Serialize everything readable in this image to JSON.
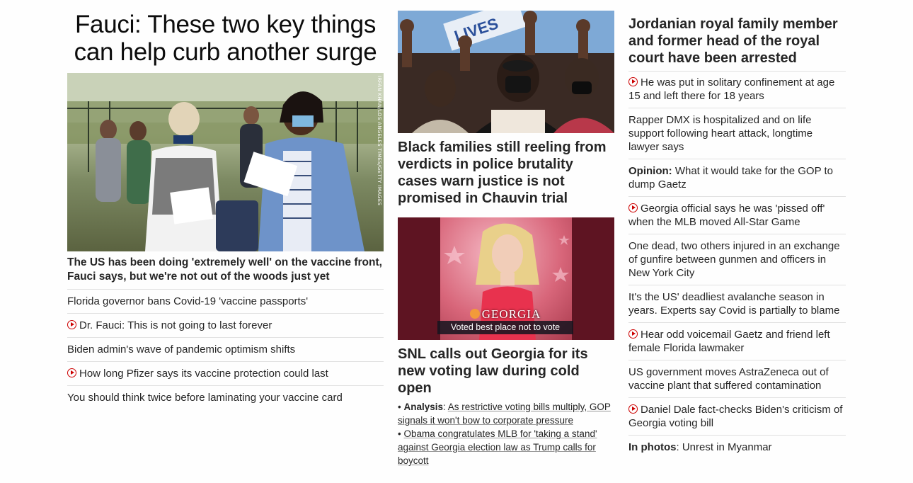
{
  "lead": {
    "headline": "Fauci: These two key things can help curb another surge",
    "photo_credit": "IRFAN KHAN/LOS ANGELES TIMES/GETTY IMAGES",
    "subhead": "The US has been doing 'extremely well' on the vaccine front, Fauci says, but we're not out of the woods just yet",
    "related": [
      {
        "text": "Florida governor bans Covid-19 'vaccine passports'",
        "video": false
      },
      {
        "text": "Dr. Fauci: This is not going to last forever",
        "video": true
      },
      {
        "text": "Biden admin's wave of pandemic optimism shifts",
        "video": false
      },
      {
        "text": "How long Pfizer says its vaccine protection could last",
        "video": true
      },
      {
        "text": "You should think twice before laminating your vaccine card",
        "video": false
      }
    ]
  },
  "middle": {
    "story1_headline": "Black families still reeling from verdicts in police brutality cases warn justice is not promised in Chauvin trial",
    "story1_sign": "LIVES",
    "story2_headline": "SNL calls out Georgia for its new voting law during cold open",
    "story2_lower_third_title": "GEORGIA",
    "story2_lower_third_caption": "Voted best place not to vote",
    "bullets": [
      {
        "prefix": "Analysis",
        "text": "As restrictive voting bills multiply, GOP signals it won't bow to corporate pressure"
      },
      {
        "prefix": "",
        "text": "Obama congratulates MLB for 'taking a stand' against Georgia election law as Trump calls for boycott"
      }
    ]
  },
  "right": {
    "headline": "Jordanian royal family member and former head of the royal court have been arrested",
    "items": [
      {
        "prefix": "",
        "text": "He was put in solitary confinement at age 15 and left there for 18 years",
        "video": true
      },
      {
        "prefix": "",
        "text": "Rapper DMX is hospitalized and on life support following heart attack, longtime lawyer says",
        "video": false
      },
      {
        "prefix": "Opinion:",
        "text": " What it would take for the GOP to dump Gaetz",
        "video": false
      },
      {
        "prefix": "",
        "text": "Georgia official says he was 'pissed off' when the MLB moved All-Star Game",
        "video": true
      },
      {
        "prefix": "",
        "text": "One dead, two others injured in an exchange of gunfire between gunmen and officers in New York City",
        "video": false
      },
      {
        "prefix": "",
        "text": "It's the US' deadliest avalanche season in years. Experts say Covid is partially to blame",
        "video": false
      },
      {
        "prefix": "",
        "text": "Hear odd voicemail Gaetz and friend left female Florida lawmaker",
        "video": true
      },
      {
        "prefix": "",
        "text": "US government moves AstraZeneca out of vaccine plant that suffered contamination",
        "video": false
      },
      {
        "prefix": "",
        "text": "Daniel Dale fact-checks Biden's criticism of Georgia voting bill",
        "video": true
      },
      {
        "prefix": "In photos",
        "text": ": Unrest in Myanmar",
        "video": false
      }
    ]
  },
  "colors": {
    "accent": "#cc0000",
    "text": "#262626",
    "divider": "#e1e1e1"
  }
}
